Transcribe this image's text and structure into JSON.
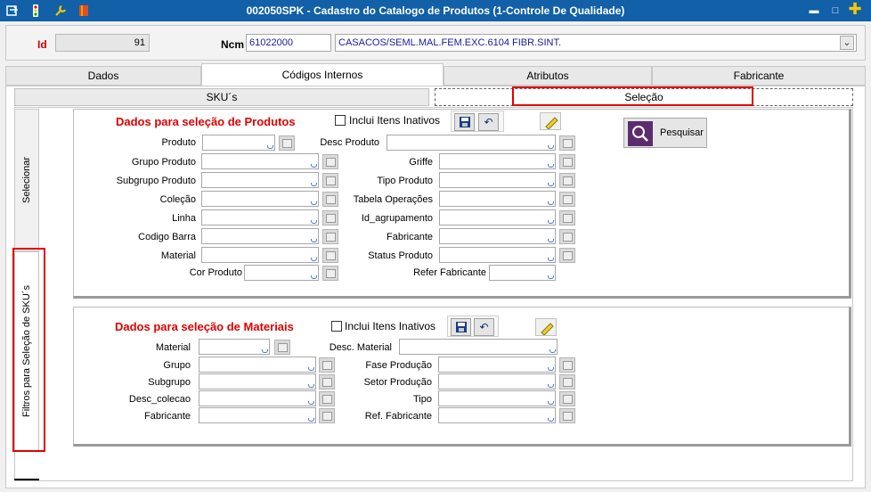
{
  "window": {
    "title": "002050SPK - Cadastro do Catalogo de Produtos (1-Controle De Qualidade)",
    "controls": {
      "minimize": "▬",
      "maximize": "□",
      "close": "✕"
    }
  },
  "header": {
    "id_label": "Id",
    "id_value": "91",
    "ncm_label": "Ncm",
    "ncm_code": "61022000",
    "ncm_description": "CASACOS/SEML.MAL.FEM.EXC.6104 FIBR.SINT."
  },
  "tabs": [
    {
      "label": "Dados"
    },
    {
      "label": "Códigos Internos"
    },
    {
      "label": "Atributos"
    },
    {
      "label": "Fabricante"
    }
  ],
  "subtabs": [
    {
      "label": "SKU´s"
    },
    {
      "label": "Seleção"
    }
  ],
  "vertical_tabs": {
    "select": "Selecionar",
    "filters": "Filtros para Seleção de SKU´s"
  },
  "products": {
    "title": "Dados para seleção de Produtos",
    "include_inactive": "Inclui Itens Inativos",
    "search_label": "Pesquisar",
    "left_fields": [
      {
        "label": "Produto"
      },
      {
        "label": "Grupo Produto"
      },
      {
        "label": "Subgrupo Produto"
      },
      {
        "label": "Coleção"
      },
      {
        "label": "Linha"
      },
      {
        "label": "Codigo Barra"
      },
      {
        "label": "Material"
      },
      {
        "label": "Cor Produto"
      }
    ],
    "right_fields": [
      {
        "label": "Desc Produto"
      },
      {
        "label": "Griffe"
      },
      {
        "label": "Tipo Produto"
      },
      {
        "label": "Tabela Operações"
      },
      {
        "label": "Id_agrupamento"
      },
      {
        "label": "Fabricante"
      },
      {
        "label": "Status Produto"
      },
      {
        "label": "Refer Fabricante"
      }
    ]
  },
  "materials": {
    "title": "Dados para seleção de Materiais",
    "include_inactive": "Inclui Itens Inativos",
    "left_fields": [
      {
        "label": "Material"
      },
      {
        "label": "Grupo"
      },
      {
        "label": "Subgrupo"
      },
      {
        "label": "Desc_colecao"
      },
      {
        "label": "Fabricante"
      }
    ],
    "right_fields": [
      {
        "label": "Desc. Material"
      },
      {
        "label": "Fase Produção"
      },
      {
        "label": "Setor Produção"
      },
      {
        "label": "Tipo"
      },
      {
        "label": "Ref. Fabricante"
      }
    ]
  },
  "colors": {
    "titlebar": "#1160a8",
    "section_title": "#e00000",
    "highlight": "#e00000",
    "search_icon_bg": "#5b2d6e"
  }
}
